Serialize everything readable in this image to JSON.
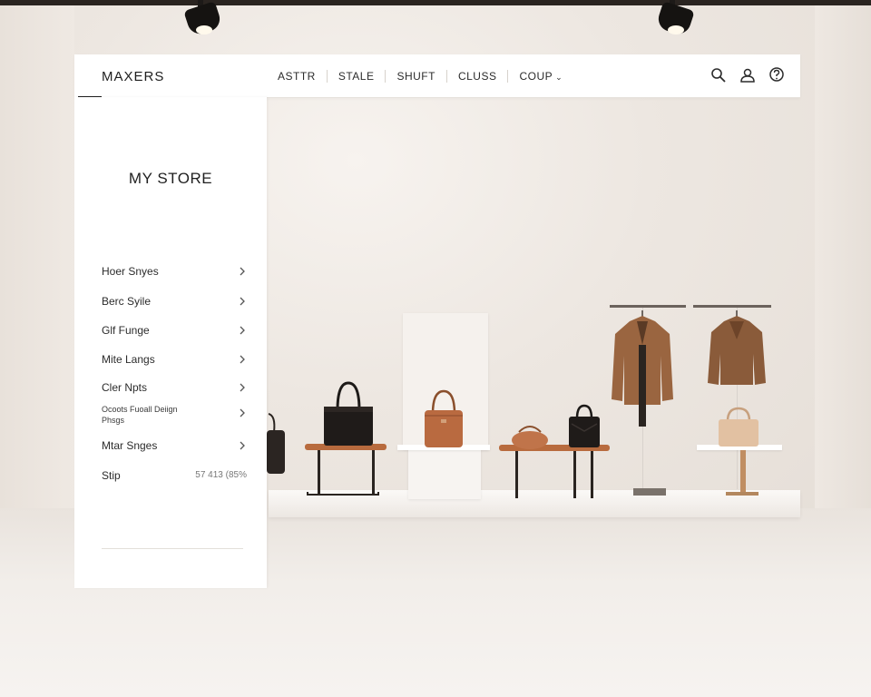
{
  "header": {
    "brand": "MAXERS",
    "nav": [
      {
        "label": "ASTTR"
      },
      {
        "label": "STALE"
      },
      {
        "label": "SHUFT"
      },
      {
        "label": "CLUSS"
      },
      {
        "label": "COUP",
        "dropdown": true
      }
    ],
    "icons": [
      "search-icon",
      "user-icon",
      "help-icon"
    ]
  },
  "sidebar": {
    "title": "MY STORE",
    "items": [
      {
        "label": "Hoer Snyes"
      },
      {
        "label": "Berc Syile"
      },
      {
        "label": "Glf Funge"
      },
      {
        "label": "Mite Langs"
      },
      {
        "label": "Cler Npts"
      },
      {
        "label": "Ocoots Fuoall Deiign\nPhsgs"
      },
      {
        "label": "Mtar Snges"
      }
    ],
    "ship": {
      "label": "Stip",
      "value": "57 413 (85%"
    }
  },
  "colors": {
    "accent_leather": "#b86b3e",
    "dark_text": "#1e1e1e",
    "wall": "#ede7e1"
  }
}
